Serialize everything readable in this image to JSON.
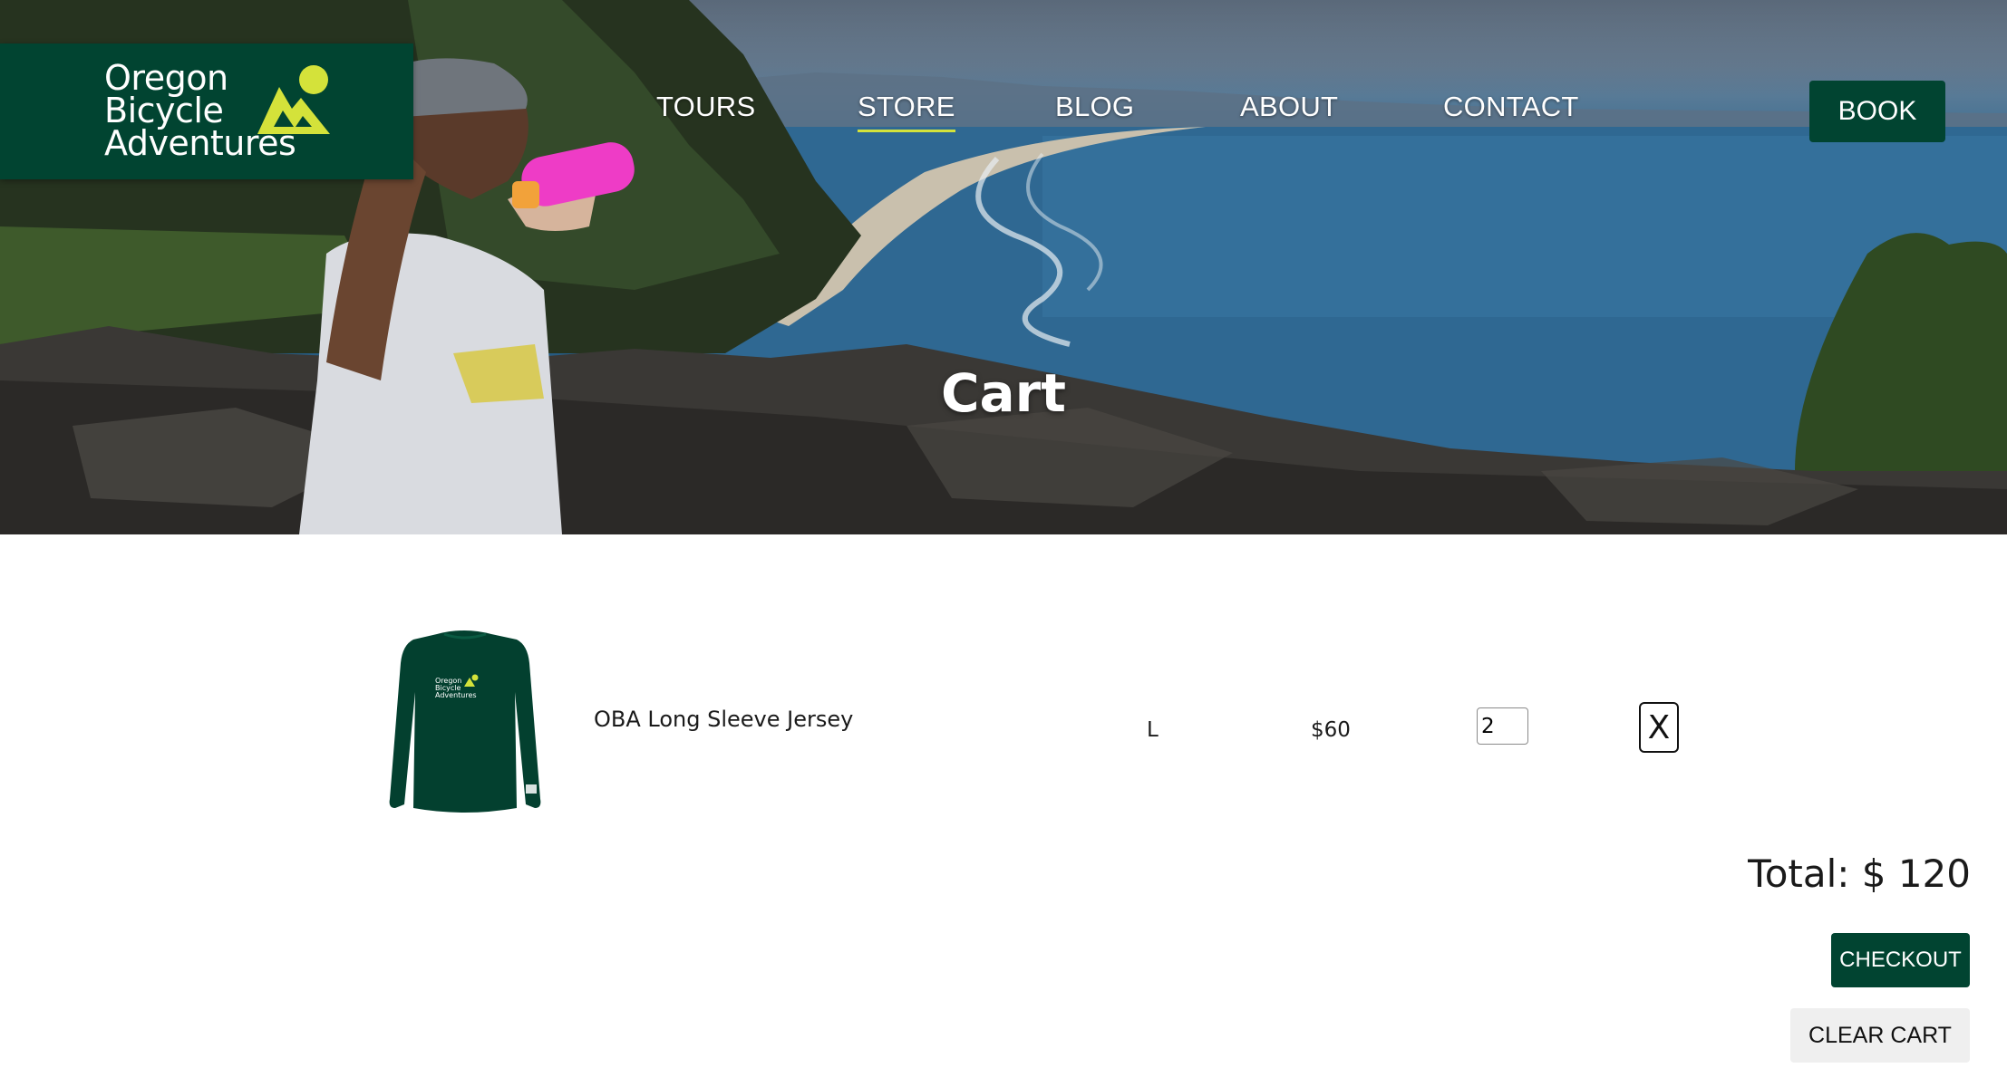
{
  "brand": {
    "line1": "Oregon",
    "line2": "Bicycle",
    "line3": "Adventures",
    "primary_color": "#014431",
    "accent_color": "#d4e23a"
  },
  "nav": {
    "items": [
      {
        "label": "TOURS",
        "active": false
      },
      {
        "label": "STORE",
        "active": true
      },
      {
        "label": "BLOG",
        "active": false
      },
      {
        "label": "ABOUT",
        "active": false
      },
      {
        "label": "CONTACT",
        "active": false
      }
    ],
    "book_label": "BOOK"
  },
  "hero": {
    "title": "Cart"
  },
  "cart": {
    "items": [
      {
        "name": "OBA Long Sleeve Jersey",
        "size": "L",
        "price": "$60",
        "quantity": "2",
        "remove_label": "X",
        "image_icon": "jersey-image"
      }
    ],
    "total_text": "Total: $ 120",
    "checkout_label": "CHECKOUT",
    "clear_label": "CLEAR CART"
  }
}
